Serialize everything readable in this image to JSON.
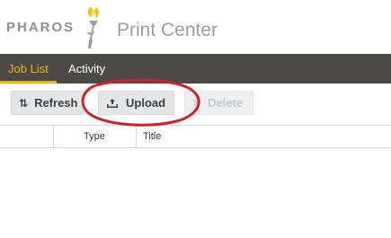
{
  "header": {
    "brand": "PHAROS",
    "product": "Print Center"
  },
  "nav": {
    "tabs": [
      {
        "label": "Job List",
        "active": true
      },
      {
        "label": "Activity",
        "active": false
      }
    ]
  },
  "toolbar": {
    "refresh_label": "Refresh",
    "upload_label": "Upload",
    "delete_label": "Delete",
    "delete_enabled": false
  },
  "table": {
    "columns": [
      "",
      "Type",
      "Title"
    ],
    "rows": []
  },
  "colors": {
    "nav_bg": "#4b4a47",
    "accent": "#f2b30a",
    "annotation_circle": "#d0212b"
  },
  "icons": {
    "refresh": "refresh-icon",
    "upload": "upload-icon",
    "delete": "close-icon",
    "logo": "torch-icon"
  }
}
